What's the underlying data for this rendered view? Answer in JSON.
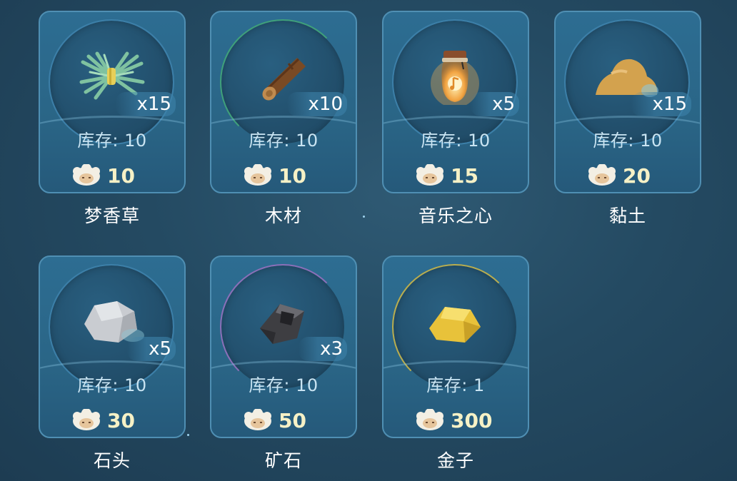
{
  "stock_label": "库存: ",
  "items": [
    {
      "name": "梦香草",
      "icon": "grass-bundle-icon",
      "quantity": "x15",
      "stock": "库存: 10",
      "price": "10",
      "ring_color": "#3c7fa8"
    },
    {
      "name": "木材",
      "icon": "wood-log-icon",
      "quantity": "x10",
      "stock": "库存: 10",
      "price": "10",
      "ring_color": "#3fa07a"
    },
    {
      "name": "音乐之心",
      "icon": "music-heart-jar-icon",
      "quantity": "x5",
      "stock": "库存: 10",
      "price": "15",
      "ring_color": "#3c7fa8"
    },
    {
      "name": "黏土",
      "icon": "clay-pile-icon",
      "quantity": "x15",
      "stock": "库存: 10",
      "price": "20",
      "ring_color": "#3c7fa8"
    },
    {
      "name": "石头",
      "icon": "stone-icon",
      "quantity": "x5",
      "stock": "库存: 10",
      "price": "30",
      "ring_color": "#3c7fa8"
    },
    {
      "name": "矿石",
      "icon": "ore-icon",
      "quantity": "x3",
      "stock": "库存: 10",
      "price": "50",
      "ring_color": "#8a6fb8"
    },
    {
      "name": "金子",
      "icon": "gold-nugget-icon",
      "quantity": "",
      "stock": "库存: 1",
      "price": "300",
      "ring_color": "#b9ad4e"
    }
  ],
  "currency_icon": "sheep-currency-icon"
}
